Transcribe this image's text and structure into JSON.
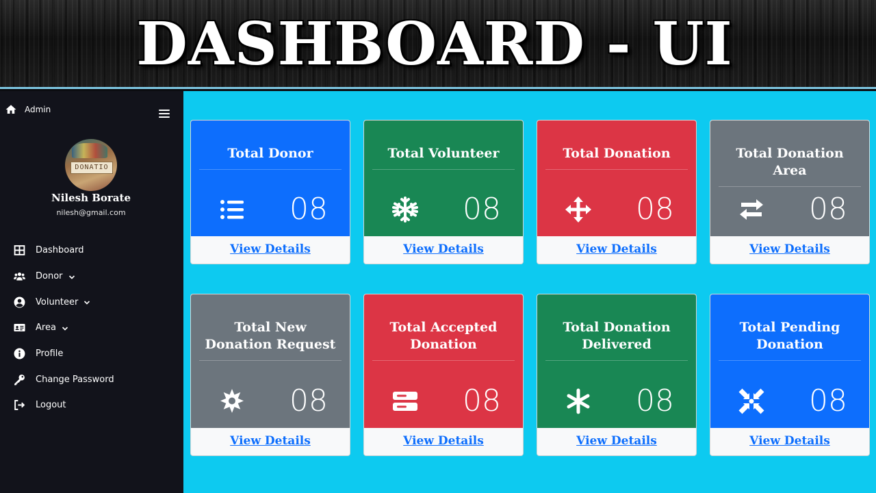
{
  "banner": {
    "title": "DASHBOARD - UI"
  },
  "sidebar": {
    "home_label": "Admin",
    "avatar_text": "DONATIO",
    "user_name": "Nilesh Borate",
    "user_email": "nilesh@gmail.com",
    "items": [
      {
        "label": "Dashboard",
        "icon": "grid-icon",
        "dropdown": false
      },
      {
        "label": "Donor",
        "icon": "users-icon",
        "dropdown": true
      },
      {
        "label": "Volunteer",
        "icon": "user-circle-icon",
        "dropdown": true
      },
      {
        "label": "Area",
        "icon": "id-card-icon",
        "dropdown": true
      },
      {
        "label": "Profile",
        "icon": "info-icon",
        "dropdown": false
      },
      {
        "label": "Change Password",
        "icon": "key-icon",
        "dropdown": false
      },
      {
        "label": "Logout",
        "icon": "logout-icon",
        "dropdown": false
      }
    ]
  },
  "cards": [
    {
      "title": "Total Donor",
      "value": "08",
      "link": "View Details",
      "color": "#0d6efd",
      "icon": "list-icon"
    },
    {
      "title": "Total Volunteer",
      "value": "08",
      "link": "View Details",
      "color": "#198754",
      "icon": "snowflake-icon"
    },
    {
      "title": "Total Donation",
      "value": "08",
      "link": "View Details",
      "color": "#dc3545",
      "icon": "arrows-move-icon"
    },
    {
      "title": "Total Donation Area",
      "value": "08",
      "link": "View Details",
      "color": "#6c757d",
      "icon": "exchange-icon"
    },
    {
      "title": "Total New Donation Request",
      "value": "08",
      "link": "View Details",
      "color": "#6c757d",
      "icon": "burst-icon"
    },
    {
      "title": "Total Accepted Donation",
      "value": "08",
      "link": "View Details",
      "color": "#dc3545",
      "icon": "server-icon"
    },
    {
      "title": "Total Donation Delivered",
      "value": "08",
      "link": "View Details",
      "color": "#198754",
      "icon": "asterisk-icon"
    },
    {
      "title": "Total Pending Donation",
      "value": "08",
      "link": "View Details",
      "color": "#0d6efd",
      "icon": "compress-icon"
    }
  ]
}
